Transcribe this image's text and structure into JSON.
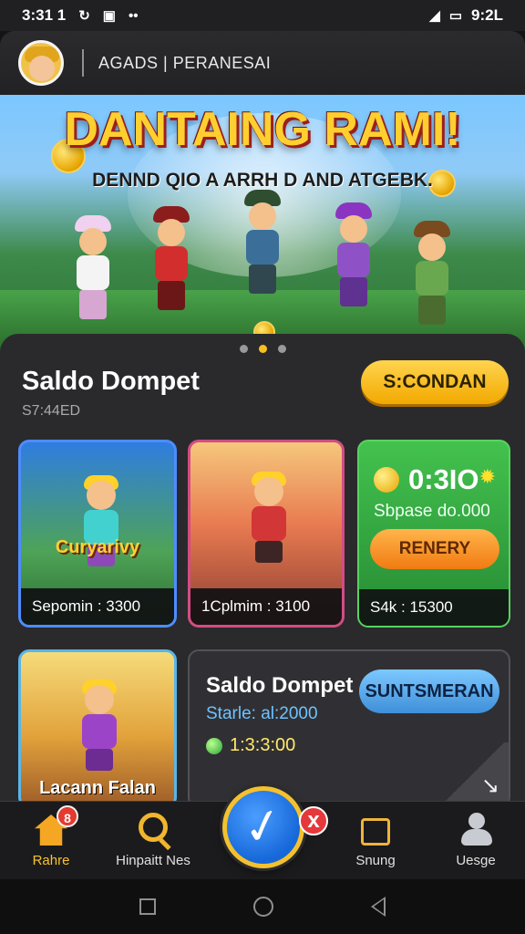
{
  "status_bar": {
    "time": "3:31 1",
    "left_icons": [
      "sync-icon",
      "image-icon",
      "more-icon"
    ],
    "right_time": "9:2L",
    "right_icons": [
      "wifi-icon",
      "signal-icon",
      "battery-icon"
    ]
  },
  "header": {
    "title": "AGADS | PERANESAI"
  },
  "banner": {
    "title": "DANTAING RAMI!",
    "subtitle": "DENND QIO A ARRH D AND ATGEBK.",
    "dots": 3,
    "active_dot": 2
  },
  "wallet": {
    "title": "Saldo Dompet",
    "subtitle": "S7:44ED",
    "collect_label": "S:CONDAN"
  },
  "cards": [
    {
      "caption": "Curyarivy",
      "label": "Sepomin : 3300"
    },
    {
      "caption": "",
      "label": "1Cplmim : 3100"
    },
    {
      "timer": "0:3IO",
      "reward": "Sbpase do.000",
      "button": "RENERY",
      "label": "S4k : 15300"
    },
    {
      "caption": "Lacann Falan",
      "label": ""
    },
    {
      "title": "Saldo Dompet",
      "amount": "Starle: al:2000",
      "time": "1:3:3:00",
      "button": "SUNTSMERAN"
    }
  ],
  "bottom_nav": {
    "items": [
      {
        "label": "Rahre",
        "badge": "8",
        "icon": "home-icon"
      },
      {
        "label": "Hinpaitt Nes",
        "badge": "",
        "icon": "search-icon"
      },
      {
        "label": "Snung",
        "badge": "",
        "icon": "calendar-icon"
      },
      {
        "label": "Uesge",
        "badge": "",
        "icon": "user-icon"
      }
    ],
    "fab": {
      "icon": "check-icon",
      "close": "x"
    }
  },
  "theme": {
    "accent": "#f7c42f",
    "background": "#2a2a2c",
    "primary": "#1667d9"
  }
}
